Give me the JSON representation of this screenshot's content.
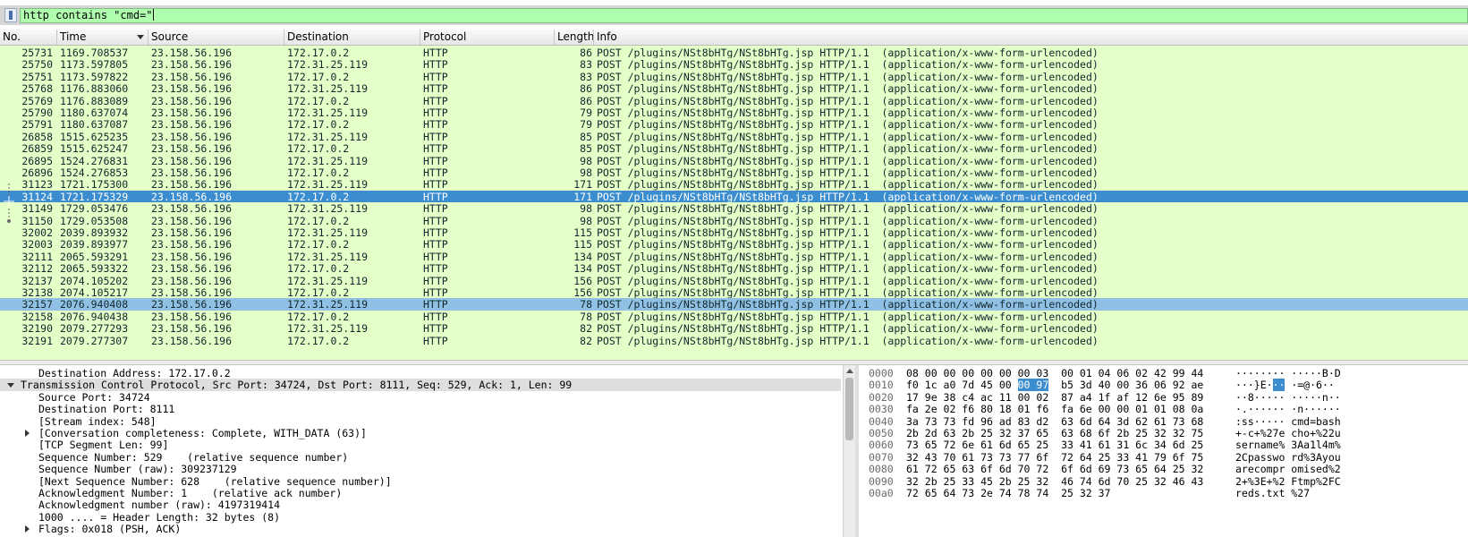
{
  "filter": {
    "value": "http contains \"cmd=\""
  },
  "columns": {
    "no": "No.",
    "time": "Time",
    "source": "Source",
    "destination": "Destination",
    "protocol": "Protocol",
    "length": "Length",
    "info": "Info"
  },
  "packets": [
    {
      "no": "25731",
      "time": "1169.708537",
      "src": "23.158.56.196",
      "dst": "172.17.0.2",
      "proto": "HTTP",
      "len": "86",
      "info": "POST /plugins/NSt8bHTg/NSt8bHTg.jsp HTTP/1.1  (application/x-www-form-urlencoded)"
    },
    {
      "no": "25750",
      "time": "1173.597805",
      "src": "23.158.56.196",
      "dst": "172.31.25.119",
      "proto": "HTTP",
      "len": "83",
      "info": "POST /plugins/NSt8bHTg/NSt8bHTg.jsp HTTP/1.1  (application/x-www-form-urlencoded)"
    },
    {
      "no": "25751",
      "time": "1173.597822",
      "src": "23.158.56.196",
      "dst": "172.17.0.2",
      "proto": "HTTP",
      "len": "83",
      "info": "POST /plugins/NSt8bHTg/NSt8bHTg.jsp HTTP/1.1  (application/x-www-form-urlencoded)"
    },
    {
      "no": "25768",
      "time": "1176.883060",
      "src": "23.158.56.196",
      "dst": "172.31.25.119",
      "proto": "HTTP",
      "len": "86",
      "info": "POST /plugins/NSt8bHTg/NSt8bHTg.jsp HTTP/1.1  (application/x-www-form-urlencoded)"
    },
    {
      "no": "25769",
      "time": "1176.883089",
      "src": "23.158.56.196",
      "dst": "172.17.0.2",
      "proto": "HTTP",
      "len": "86",
      "info": "POST /plugins/NSt8bHTg/NSt8bHTg.jsp HTTP/1.1  (application/x-www-form-urlencoded)"
    },
    {
      "no": "25790",
      "time": "1180.637074",
      "src": "23.158.56.196",
      "dst": "172.31.25.119",
      "proto": "HTTP",
      "len": "79",
      "info": "POST /plugins/NSt8bHTg/NSt8bHTg.jsp HTTP/1.1  (application/x-www-form-urlencoded)"
    },
    {
      "no": "25791",
      "time": "1180.637087",
      "src": "23.158.56.196",
      "dst": "172.17.0.2",
      "proto": "HTTP",
      "len": "79",
      "info": "POST /plugins/NSt8bHTg/NSt8bHTg.jsp HTTP/1.1  (application/x-www-form-urlencoded)"
    },
    {
      "no": "26858",
      "time": "1515.625235",
      "src": "23.158.56.196",
      "dst": "172.31.25.119",
      "proto": "HTTP",
      "len": "85",
      "info": "POST /plugins/NSt8bHTg/NSt8bHTg.jsp HTTP/1.1  (application/x-www-form-urlencoded)"
    },
    {
      "no": "26859",
      "time": "1515.625247",
      "src": "23.158.56.196",
      "dst": "172.17.0.2",
      "proto": "HTTP",
      "len": "85",
      "info": "POST /plugins/NSt8bHTg/NSt8bHTg.jsp HTTP/1.1  (application/x-www-form-urlencoded)"
    },
    {
      "no": "26895",
      "time": "1524.276831",
      "src": "23.158.56.196",
      "dst": "172.31.25.119",
      "proto": "HTTP",
      "len": "98",
      "info": "POST /plugins/NSt8bHTg/NSt8bHTg.jsp HTTP/1.1  (application/x-www-form-urlencoded)"
    },
    {
      "no": "26896",
      "time": "1524.276853",
      "src": "23.158.56.196",
      "dst": "172.17.0.2",
      "proto": "HTTP",
      "len": "98",
      "info": "POST /plugins/NSt8bHTg/NSt8bHTg.jsp HTTP/1.1  (application/x-www-form-urlencoded)"
    },
    {
      "no": "31123",
      "time": "1721.175300",
      "src": "23.158.56.196",
      "dst": "172.31.25.119",
      "proto": "HTTP",
      "len": "171",
      "info": "POST /plugins/NSt8bHTg/NSt8bHTg.jsp HTTP/1.1  (application/x-www-form-urlencoded)"
    },
    {
      "no": "31124",
      "time": "1721.175329",
      "src": "23.158.56.196",
      "dst": "172.17.0.2",
      "proto": "HTTP",
      "len": "171",
      "info": "POST /plugins/NSt8bHTg/NSt8bHTg.jsp HTTP/1.1  (application/x-www-form-urlencoded)"
    },
    {
      "no": "31149",
      "time": "1729.053476",
      "src": "23.158.56.196",
      "dst": "172.31.25.119",
      "proto": "HTTP",
      "len": "98",
      "info": "POST /plugins/NSt8bHTg/NSt8bHTg.jsp HTTP/1.1  (application/x-www-form-urlencoded)"
    },
    {
      "no": "31150",
      "time": "1729.053508",
      "src": "23.158.56.196",
      "dst": "172.17.0.2",
      "proto": "HTTP",
      "len": "98",
      "info": "POST /plugins/NSt8bHTg/NSt8bHTg.jsp HTTP/1.1  (application/x-www-form-urlencoded)"
    },
    {
      "no": "32002",
      "time": "2039.893932",
      "src": "23.158.56.196",
      "dst": "172.31.25.119",
      "proto": "HTTP",
      "len": "115",
      "info": "POST /plugins/NSt8bHTg/NSt8bHTg.jsp HTTP/1.1  (application/x-www-form-urlencoded)"
    },
    {
      "no": "32003",
      "time": "2039.893977",
      "src": "23.158.56.196",
      "dst": "172.17.0.2",
      "proto": "HTTP",
      "len": "115",
      "info": "POST /plugins/NSt8bHTg/NSt8bHTg.jsp HTTP/1.1  (application/x-www-form-urlencoded)"
    },
    {
      "no": "32111",
      "time": "2065.593291",
      "src": "23.158.56.196",
      "dst": "172.31.25.119",
      "proto": "HTTP",
      "len": "134",
      "info": "POST /plugins/NSt8bHTg/NSt8bHTg.jsp HTTP/1.1  (application/x-www-form-urlencoded)"
    },
    {
      "no": "32112",
      "time": "2065.593322",
      "src": "23.158.56.196",
      "dst": "172.17.0.2",
      "proto": "HTTP",
      "len": "134",
      "info": "POST /plugins/NSt8bHTg/NSt8bHTg.jsp HTTP/1.1  (application/x-www-form-urlencoded)"
    },
    {
      "no": "32137",
      "time": "2074.105202",
      "src": "23.158.56.196",
      "dst": "172.31.25.119",
      "proto": "HTTP",
      "len": "156",
      "info": "POST /plugins/NSt8bHTg/NSt8bHTg.jsp HTTP/1.1  (application/x-www-form-urlencoded)"
    },
    {
      "no": "32138",
      "time": "2074.105217",
      "src": "23.158.56.196",
      "dst": "172.17.0.2",
      "proto": "HTTP",
      "len": "156",
      "info": "POST /plugins/NSt8bHTg/NSt8bHTg.jsp HTTP/1.1  (application/x-www-form-urlencoded)"
    },
    {
      "no": "32157",
      "time": "2076.940408",
      "src": "23.158.56.196",
      "dst": "172.31.25.119",
      "proto": "HTTP",
      "len": "78",
      "info": "POST /plugins/NSt8bHTg/NSt8bHTg.jsp HTTP/1.1  (application/x-www-form-urlencoded)"
    },
    {
      "no": "32158",
      "time": "2076.940438",
      "src": "23.158.56.196",
      "dst": "172.17.0.2",
      "proto": "HTTP",
      "len": "78",
      "info": "POST /plugins/NSt8bHTg/NSt8bHTg.jsp HTTP/1.1  (application/x-www-form-urlencoded)"
    },
    {
      "no": "32190",
      "time": "2079.277293",
      "src": "23.158.56.196",
      "dst": "172.31.25.119",
      "proto": "HTTP",
      "len": "82",
      "info": "POST /plugins/NSt8bHTg/NSt8bHTg.jsp HTTP/1.1  (application/x-www-form-urlencoded)"
    },
    {
      "no": "32191",
      "time": "2079.277307",
      "src": "23.158.56.196",
      "dst": "172.17.0.2",
      "proto": "HTTP",
      "len": "82",
      "info": "POST /plugins/NSt8bHTg/NSt8bHTg.jsp HTTP/1.1  (application/x-www-form-urlencoded)"
    }
  ],
  "selected_packet": "31124",
  "related_packet": "32157",
  "details": [
    {
      "indent": 2,
      "tw": "",
      "text": "Destination Address: 172.17.0.2"
    },
    {
      "indent": 0,
      "tw": "open",
      "text": "Transmission Control Protocol, Src Port: 34724, Dst Port: 8111, Seq: 529, Ack: 1, Len: 99",
      "highlight": true
    },
    {
      "indent": 2,
      "tw": "",
      "text": "Source Port: 34724"
    },
    {
      "indent": 2,
      "tw": "",
      "text": "Destination Port: 8111"
    },
    {
      "indent": 2,
      "tw": "",
      "text": "[Stream index: 548]"
    },
    {
      "indent": 1,
      "tw": "closed",
      "text": "[Conversation completeness: Complete, WITH_DATA (63)]"
    },
    {
      "indent": 2,
      "tw": "",
      "text": "[TCP Segment Len: 99]"
    },
    {
      "indent": 2,
      "tw": "",
      "text": "Sequence Number: 529    (relative sequence number)"
    },
    {
      "indent": 2,
      "tw": "",
      "text": "Sequence Number (raw): 309237129"
    },
    {
      "indent": 2,
      "tw": "",
      "text": "[Next Sequence Number: 628    (relative sequence number)]"
    },
    {
      "indent": 2,
      "tw": "",
      "text": "Acknowledgment Number: 1    (relative ack number)"
    },
    {
      "indent": 2,
      "tw": "",
      "text": "Acknowledgment number (raw): 4197319414"
    },
    {
      "indent": 2,
      "tw": "",
      "text": "1000 .... = Header Length: 32 bytes (8)"
    },
    {
      "indent": 1,
      "tw": "closed",
      "text": "Flags: 0x018 (PSH, ACK)"
    }
  ],
  "bytes": [
    {
      "offset": "0000",
      "hex_a": "08 00 00 00 00 00 00 03",
      "hex_b": "00 01 04 06 02 42 99 44",
      "ascii": "········ ·····B·D"
    },
    {
      "offset": "0010",
      "hex_a": "f0 1c a0 7d 45 00 ",
      "hex_sel": "00 97",
      "hex_b": "b5 3d 40 00 36 06 92 ae",
      "ascii_a": "···}E·",
      "ascii_sel": "··",
      "ascii_b": " ·=@·6··"
    },
    {
      "offset": "0020",
      "hex_a": "17 9e 38 c4 ac 11 00 02",
      "hex_b": "87 a4 1f af 12 6e 95 89",
      "ascii": "··8····· ·····n··"
    },
    {
      "offset": "0030",
      "hex_a": "fa 2e 02 f6 80 18 01 f6",
      "hex_b": "fa 6e 00 00 01 01 08 0a",
      "ascii": "·.······ ·n······"
    },
    {
      "offset": "0040",
      "hex_a": "3a 73 73 fd 96 ad 83 d2",
      "hex_b": "63 6d 64 3d 62 61 73 68",
      "ascii": ":ss····· cmd=bash"
    },
    {
      "offset": "0050",
      "hex_a": "2b 2d 63 2b 25 32 37 65",
      "hex_b": "63 68 6f 2b 25 32 32 75",
      "ascii": "+-c+%27e cho+%22u"
    },
    {
      "offset": "0060",
      "hex_a": "73 65 72 6e 61 6d 65 25",
      "hex_b": "33 41 61 31 6c 34 6d 25",
      "ascii": "sername% 3Aa1l4m%"
    },
    {
      "offset": "0070",
      "hex_a": "32 43 70 61 73 73 77 6f",
      "hex_b": "72 64 25 33 41 79 6f 75",
      "ascii": "2Cpasswo rd%3Ayou"
    },
    {
      "offset": "0080",
      "hex_a": "61 72 65 63 6f 6d 70 72",
      "hex_b": "6f 6d 69 73 65 64 25 32",
      "ascii": "arecompr omised%2"
    },
    {
      "offset": "0090",
      "hex_a": "32 2b 25 33 45 2b 25 32",
      "hex_b": "46 74 6d 70 25 32 46 43",
      "ascii": "2+%3E+%2 Ftmp%2FC"
    },
    {
      "offset": "00a0",
      "hex_a": "72 65 64 73 2e 74 78 74",
      "hex_b": "25 32 37",
      "ascii": "reds.txt %27"
    }
  ]
}
